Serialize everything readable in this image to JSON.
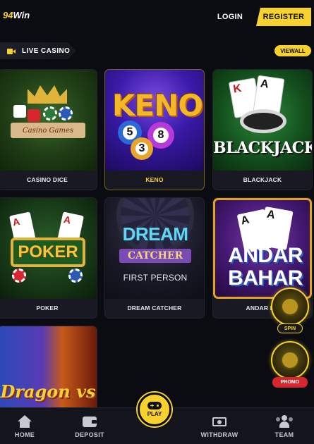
{
  "header": {
    "logo_number": "94",
    "logo_word": "Win",
    "login_label": "LOGIN",
    "register_label": "REGISTER"
  },
  "section": {
    "title": "LIVE CASINO",
    "icon": "camera-icon",
    "view_all_label": "VIEWALL"
  },
  "games": [
    {
      "label": "CASINO DICE",
      "art_text": "Casino Games",
      "selected": false
    },
    {
      "label": "KENO",
      "art_text": "KENO",
      "balls": [
        "5",
        "8",
        "3"
      ],
      "selected": true
    },
    {
      "label": "BLACKJACK",
      "art_text": "BLACKJACK",
      "cards": [
        "K",
        "A"
      ],
      "selected": false
    },
    {
      "label": "POKER",
      "art_text": "POKER",
      "cards": [
        "A",
        "A"
      ],
      "selected": false
    },
    {
      "label": "DREAM CATCHER",
      "art_text_1": "DREAM",
      "art_text_2": "CATCHER",
      "art_text_3": "FIRST PERSON",
      "selected": false
    },
    {
      "label": "ANDAR BA",
      "art_text_1": "ANDAR",
      "art_text_2": "BAHAR",
      "cards": [
        "A",
        "A"
      ],
      "selected": false
    },
    {
      "label": "",
      "art_text": "Dragon vs",
      "selected": false
    }
  ],
  "floating": {
    "spin_label": "SPIN",
    "promo_label": "PROMO"
  },
  "bottom_nav": {
    "items": [
      {
        "label": "HOME",
        "icon": "home-icon"
      },
      {
        "label": "DEPOSIT",
        "icon": "wallet-icon"
      },
      {
        "label": "PLAY",
        "icon": "gamepad-icon"
      },
      {
        "label": "WITHDRAW",
        "icon": "withdraw-icon"
      },
      {
        "label": "TEAM",
        "icon": "team-icon"
      }
    ]
  },
  "colors": {
    "accent": "#f7d12e",
    "background": "#0b0c12",
    "card": "#181922",
    "promo_red": "#d8262e"
  }
}
